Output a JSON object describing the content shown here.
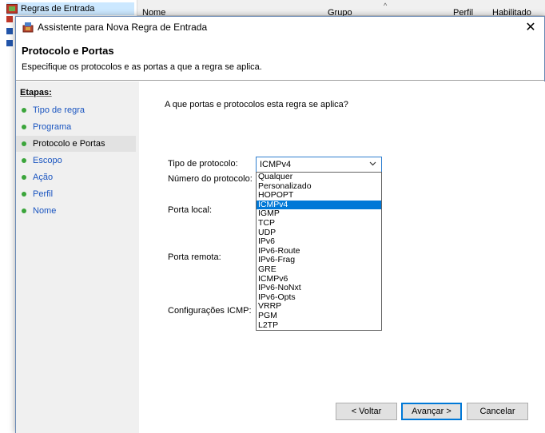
{
  "background": {
    "tree_item": "Regras de Entrada",
    "columns": [
      "Nome",
      "Grupo",
      "Perfil",
      "Habilitado"
    ]
  },
  "dialog": {
    "title": "Assistente para Nova Regra de Entrada",
    "close_label": "✕",
    "page_title": "Protocolo e Portas",
    "page_subtitle": "Especifique os protocolos e as portas a que a regra se aplica."
  },
  "steps": {
    "title": "Etapas:",
    "items": [
      {
        "label": "Tipo de regra"
      },
      {
        "label": "Programa"
      },
      {
        "label": "Protocolo e Portas"
      },
      {
        "label": "Escopo"
      },
      {
        "label": "Ação"
      },
      {
        "label": "Perfil"
      },
      {
        "label": "Nome"
      }
    ],
    "current_index": 2
  },
  "content": {
    "question": "A que portas e protocolos esta regra se aplica?",
    "protocol_type_label": "Tipo de protocolo:",
    "protocol_number_label": "Número do protocolo:",
    "local_port_label": "Porta local:",
    "remote_port_label": "Porta remota:",
    "icmp_settings_label": "Configurações ICMP:",
    "protocol_select": {
      "value": "ICMPv4",
      "options": [
        "Qualquer",
        "Personalizado",
        "HOPOPT",
        "ICMPv4",
        "IGMP",
        "TCP",
        "UDP",
        "IPv6",
        "IPv6-Route",
        "IPv6-Frag",
        "GRE",
        "ICMPv6",
        "IPv6-NoNxt",
        "IPv6-Opts",
        "VRRP",
        "PGM",
        "L2TP"
      ],
      "highlighted": "ICMPv4"
    }
  },
  "buttons": {
    "back": "< Voltar",
    "next": "Avançar >",
    "cancel": "Cancelar"
  },
  "colors": {
    "accent": "#0078d7",
    "step_link": "#1a55c0",
    "step_dot": "#3ba53b",
    "steps_bg": "#f0f0f0"
  }
}
